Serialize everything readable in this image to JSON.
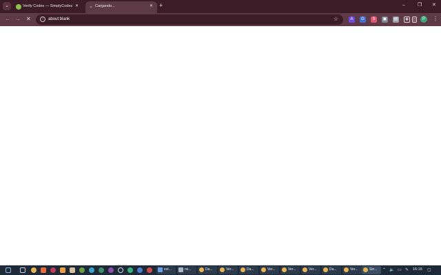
{
  "browser": {
    "tabs": [
      {
        "title": "Verify Codes — SimplyCodes",
        "close": "✕"
      },
      {
        "title": "Cargando...",
        "close": "✕",
        "favicon": "⌄"
      }
    ],
    "tab_search_glyph": "⌄",
    "new_tab_glyph": "+",
    "window_controls": {
      "minimize": "–",
      "restore": "❐",
      "close": "✕"
    },
    "nav": {
      "back": "←",
      "forward": "→",
      "stop": "✕"
    },
    "omnibox": {
      "info_glyph": "i",
      "url": "about:blank",
      "star_glyph": "☆"
    },
    "extensions": [
      {
        "name": "ext-a-icon",
        "color": "#6b4ce0",
        "glyph": "A"
      },
      {
        "name": "ext-translate-icon",
        "color": "#3d6fd6",
        "glyph": "G"
      },
      {
        "name": "ext-shop-icon",
        "color": "#e05570",
        "glyph": "S"
      },
      {
        "name": "ext-screen-icon",
        "color": "#7e8894",
        "glyph": "▣"
      },
      {
        "name": "ext-cast-icon",
        "color": "#9aa3ad",
        "glyph": "▤"
      },
      {
        "name": "ext-puzzle-icon",
        "color": "#5e3a47",
        "glyph": "✚"
      },
      {
        "name": "ext-sidepanel-icon",
        "color": "#5e3a47",
        "glyph": "▯"
      }
    ],
    "profile_initial": "P",
    "menu_glyph": "⋮"
  },
  "taskbar": {
    "buttons": [
      "ext...",
      "mi...",
      "Da...",
      "Ver...",
      "Da...",
      "Ver...",
      "Ver...",
      "Ver...",
      "Da...",
      "Ver...",
      "Sin..."
    ],
    "tray_glyphs": [
      "⌃",
      "🔈",
      "▭",
      "✎"
    ],
    "clock": "16:16",
    "notification_glyph": "▢"
  }
}
